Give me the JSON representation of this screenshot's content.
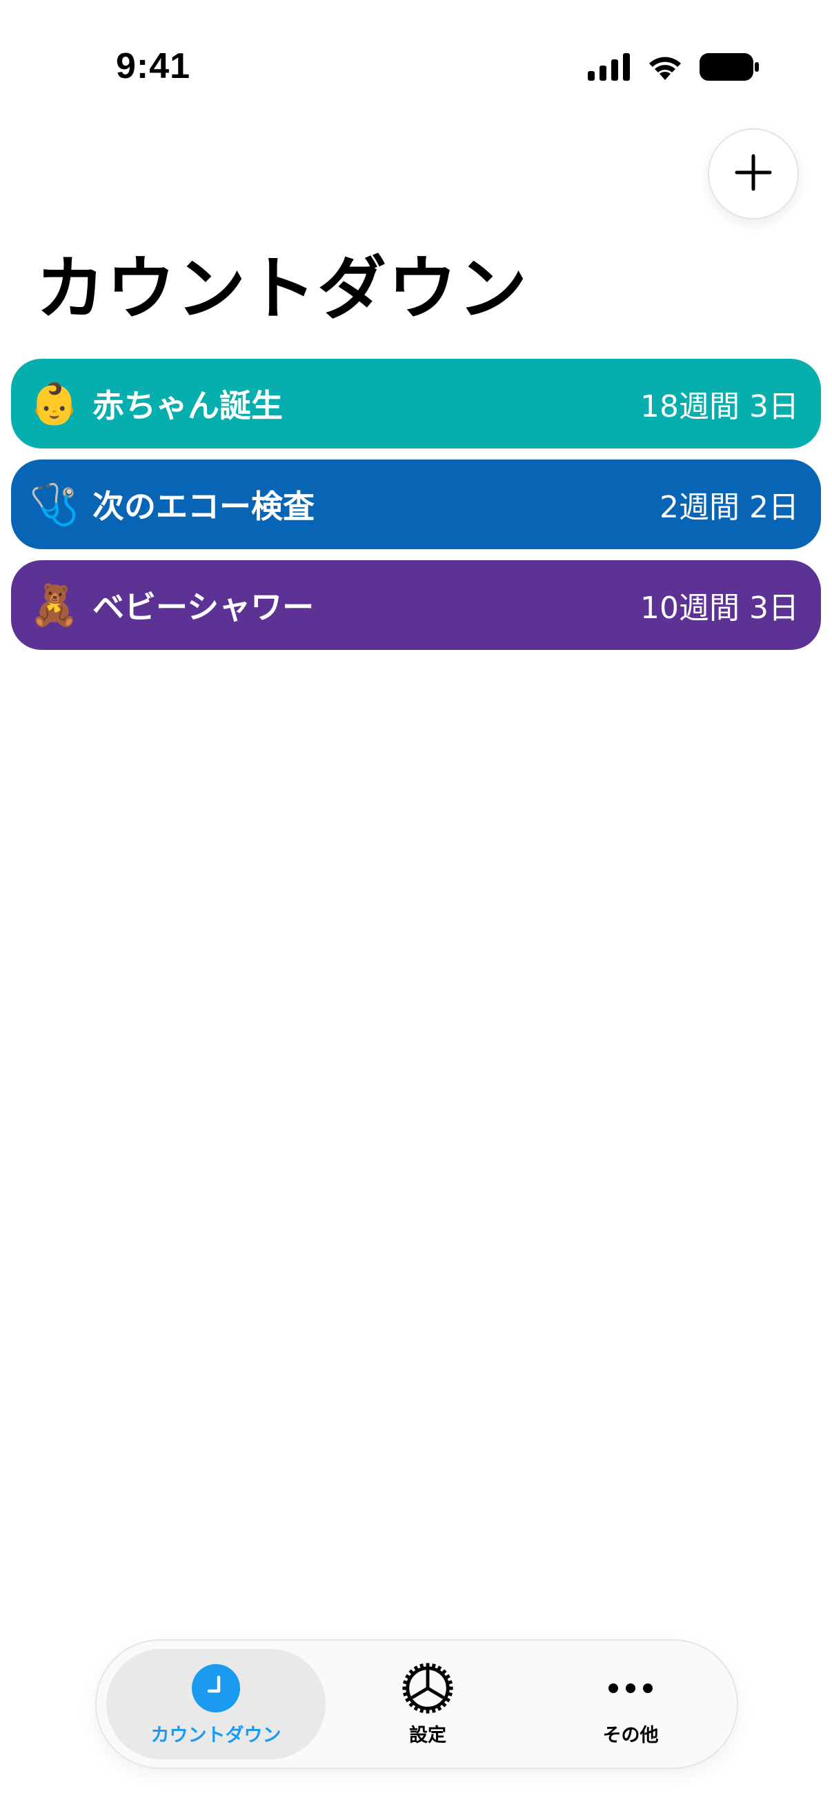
{
  "status_bar": {
    "time": "9:41",
    "icons": [
      "cellular-signal-icon",
      "wifi-icon",
      "battery-icon"
    ]
  },
  "header": {
    "add_button_icon": "plus-icon",
    "title": "カウントダウン"
  },
  "countdowns": [
    {
      "emoji": "👶",
      "label": "赤ちゃん誕生",
      "remaining": "18週間 3日",
      "color": "#06aeae"
    },
    {
      "emoji": "🩺",
      "label": "次のエコー検査",
      "remaining": "2週間 2日",
      "color": "#0864b4"
    },
    {
      "emoji": "🧸",
      "label": "ベビーシャワー",
      "remaining": "10週間 3日",
      "color": "#5c3294"
    }
  ],
  "tab_bar": {
    "tabs": [
      {
        "label": "カウントダウン",
        "icon": "clock-icon",
        "active": true
      },
      {
        "label": "設定",
        "icon": "gear-icon",
        "active": false
      },
      {
        "label": "その他",
        "icon": "ellipsis-icon",
        "active": false
      }
    ],
    "accent_color": "#1a9bf0"
  }
}
